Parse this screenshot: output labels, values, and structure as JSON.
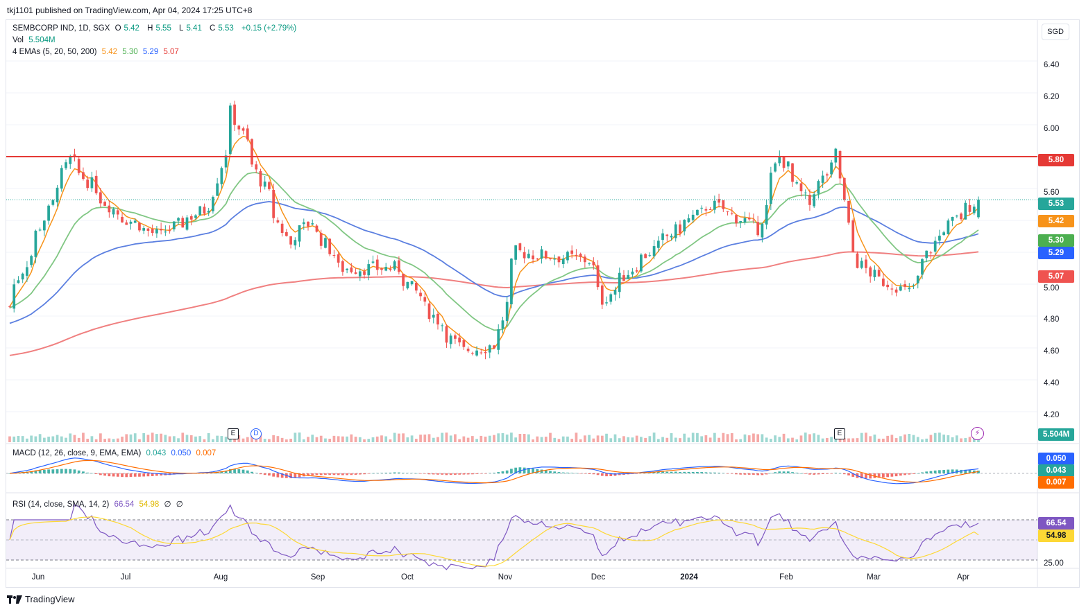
{
  "publisher": "tkj1101 published on TradingView.com, Apr 04, 2024 17:25 UTC+8",
  "currency_button": "SGD",
  "legend": {
    "symbol": "SEMBCORP IND, 1D, SGX",
    "open_label": "O",
    "open": "5.42",
    "high_label": "H",
    "high": "5.55",
    "low_label": "L",
    "low": "5.41",
    "close_label": "C",
    "close": "5.53",
    "change": "+0.15 (+2.79%)",
    "vol_label": "Vol",
    "vol": "5.504M",
    "ema_label": "4 EMAs (5, 20, 50, 200)",
    "ema5": "5.42",
    "ema20": "5.30",
    "ema50": "5.29",
    "ema200": "5.07",
    "macd_label": "MACD (12, 26, close, 9, EMA, EMA)",
    "macd_hist": "0.043",
    "macd_line": "0.050",
    "macd_signal": "0.007",
    "rsi_label": "RSI (14, close, SMA, 14, 2)",
    "rsi": "66.54",
    "rsi_ma": "54.98",
    "rsi_extra1": "∅",
    "rsi_extra2": "∅"
  },
  "colors": {
    "up": "#26a69a",
    "down": "#ef5350",
    "ema5": "#f7931a",
    "ema20": "#81c784",
    "ema50": "#5b7fe0",
    "ema200": "#f08080",
    "resistance": "#e53935",
    "macd_line": "#2962ff",
    "signal_line": "#ff6d00",
    "rsi": "#7e57c2",
    "rsi_ma": "#fdd835"
  },
  "price_axis": {
    "ticks": [
      "6.40",
      "6.20",
      "6.00",
      "5.80",
      "5.60",
      "5.40",
      "5.20",
      "5.00",
      "4.80",
      "4.60",
      "4.40",
      "4.20"
    ],
    "tags": {
      "resistance": "5.80",
      "last": "5.53",
      "ema5": "5.42",
      "ema20": "5.30",
      "ema50": "5.29",
      "ema200": "5.07",
      "volume": "5.504M"
    }
  },
  "macd_axis": {
    "tags": {
      "macd": "0.050",
      "hist": "0.043",
      "signal": "0.007"
    }
  },
  "rsi_axis": {
    "tags": {
      "rsi": "66.54",
      "rsi_ma": "54.98"
    },
    "ticks": [
      "25.00"
    ]
  },
  "x_axis": {
    "labels": [
      "Jun",
      "Jul",
      "Aug",
      "Sep",
      "Oct",
      "Nov",
      "Dec",
      "2024",
      "Feb",
      "Mar",
      "Apr"
    ]
  },
  "event_markers": [
    "E",
    "D",
    "E"
  ],
  "footer": "TradingView",
  "chart_data": {
    "type": "candlestick",
    "symbol": "SEMBCORP IND",
    "timeframe": "1D",
    "exchange": "SGX",
    "resistance_level": 5.8,
    "ylim": [
      4.15,
      6.5
    ],
    "series": [
      {
        "name": "EMA 5",
        "last": 5.42
      },
      {
        "name": "EMA 20",
        "last": 5.3
      },
      {
        "name": "EMA 50",
        "last": 5.29
      },
      {
        "name": "EMA 200",
        "last": 5.07
      }
    ],
    "key_points": [
      {
        "x": "2023-05-26",
        "close": 4.86
      },
      {
        "x": "2023-06-15",
        "close": 5.78
      },
      {
        "x": "2023-06-30",
        "close": 5.45
      },
      {
        "x": "2023-07-14",
        "close": 5.3
      },
      {
        "x": "2023-07-31",
        "close": 5.5
      },
      {
        "x": "2023-08-07",
        "close": 6.08
      },
      {
        "x": "2023-08-16",
        "close": 5.65
      },
      {
        "x": "2023-08-25",
        "close": 5.25
      },
      {
        "x": "2023-09-01",
        "close": 5.4
      },
      {
        "x": "2023-09-11",
        "close": 5.1
      },
      {
        "x": "2023-09-29",
        "close": 5.1
      },
      {
        "x": "2023-10-09",
        "close": 4.85
      },
      {
        "x": "2023-10-20",
        "close": 4.58
      },
      {
        "x": "2023-10-31",
        "close": 4.62
      },
      {
        "x": "2023-11-07",
        "close": 5.2
      },
      {
        "x": "2023-11-30",
        "close": 5.15
      },
      {
        "x": "2023-12-05",
        "close": 4.9
      },
      {
        "x": "2023-12-15",
        "close": 5.12
      },
      {
        "x": "2023-12-29",
        "close": 5.35
      },
      {
        "x": "2024-01-09",
        "close": 5.5
      },
      {
        "x": "2024-01-24",
        "close": 5.35
      },
      {
        "x": "2024-01-31",
        "close": 5.8
      },
      {
        "x": "2024-02-09",
        "close": 5.5
      },
      {
        "x": "2024-02-19",
        "close": 5.82
      },
      {
        "x": "2024-02-23",
        "close": 5.2
      },
      {
        "x": "2024-03-01",
        "close": 5.05
      },
      {
        "x": "2024-03-13",
        "close": 4.95
      },
      {
        "x": "2024-03-22",
        "close": 5.3
      },
      {
        "x": "2024-04-04",
        "close": 5.53
      }
    ],
    "volume_last": "5.504M",
    "macd": {
      "macd": 0.05,
      "signal": 0.007,
      "histogram": 0.043
    },
    "rsi": {
      "rsi": 66.54,
      "ma": 54.98
    }
  }
}
